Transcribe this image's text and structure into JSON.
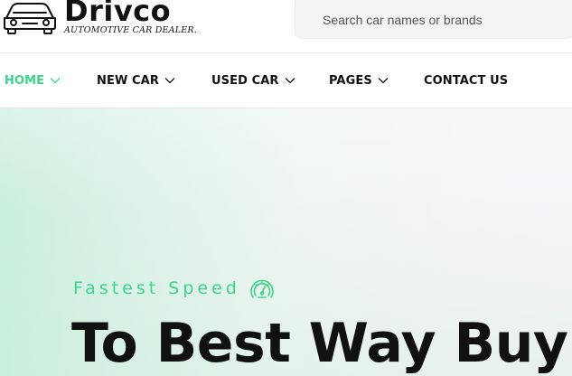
{
  "brand": {
    "name": "Drivco",
    "tagline": "AUTOMOTIVE CAR DEALER."
  },
  "search": {
    "placeholder": "Search car names or brands"
  },
  "nav": {
    "items": [
      {
        "label": "HOME",
        "has_dropdown": true,
        "active": true
      },
      {
        "label": "NEW CAR",
        "has_dropdown": true,
        "active": false
      },
      {
        "label": "USED CAR",
        "has_dropdown": true,
        "active": false
      },
      {
        "label": "PAGES",
        "has_dropdown": true,
        "active": false
      },
      {
        "label": "CONTACT US",
        "has_dropdown": false,
        "active": false
      }
    ]
  },
  "hero": {
    "subtitle": "Fastest Speed",
    "subtitle_icon": "speedometer-icon",
    "headline": "To Best Way Buy"
  },
  "colors": {
    "accent": "#3bd48a",
    "text": "#111111",
    "search_bg": "#f4f4f6"
  }
}
